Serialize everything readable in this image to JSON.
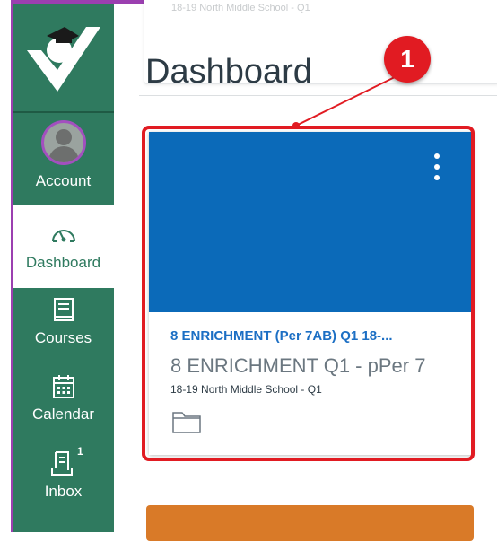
{
  "page": {
    "title": "Dashboard"
  },
  "nav": {
    "account": {
      "label": "Account",
      "icon": "avatar"
    },
    "dashboard": {
      "label": "Dashboard",
      "icon": "speedometer-icon"
    },
    "courses": {
      "label": "Courses",
      "icon": "book-icon"
    },
    "calendar": {
      "label": "Calendar",
      "icon": "calendar-icon"
    },
    "inbox": {
      "label": "Inbox",
      "icon": "inbox-icon",
      "badge": "1"
    }
  },
  "ghost_card": {
    "text": "18-19 North Middle School - Q1"
  },
  "course_card": {
    "title": "8 ENRICHMENT (Per 7AB) Q1 18-...",
    "subtitle": "8 ENRICHMENT Q1 - pPer 7",
    "term": "18-19 North Middle School - Q1",
    "color": "#0b6ab9"
  },
  "callout": {
    "number": "1",
    "color": "#e11b22"
  },
  "colors": {
    "sidebar": "#2f7a5f",
    "next_card": "#d97a28"
  }
}
